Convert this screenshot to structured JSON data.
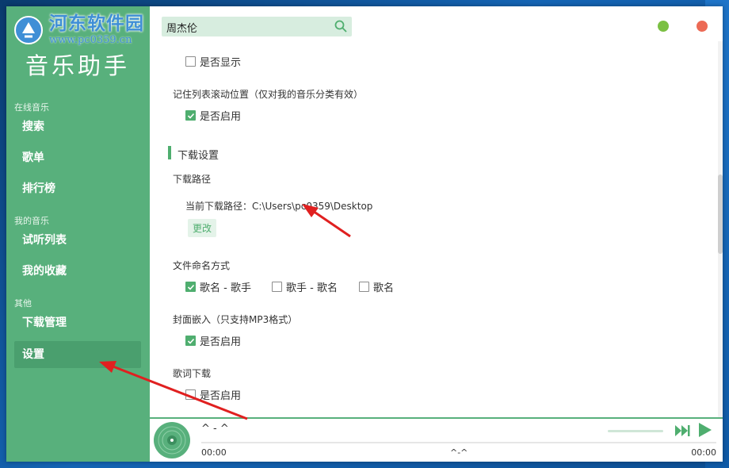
{
  "watermark": {
    "text": "河东软件园",
    "url": "www.pc0359.cn"
  },
  "app": {
    "title": "音乐助手"
  },
  "sidebar": {
    "sections": [
      {
        "label": "在线音乐",
        "items": [
          "搜索",
          "歌单",
          "排行榜"
        ]
      },
      {
        "label": "我的音乐",
        "items": [
          "试听列表",
          "我的收藏"
        ]
      },
      {
        "label": "其他",
        "items": [
          "下载管理",
          "设置"
        ]
      }
    ],
    "active_item": "设置"
  },
  "search": {
    "value": "周杰伦"
  },
  "settings": {
    "show_option": {
      "label": "是否显示",
      "checked": false
    },
    "remember_scroll": {
      "title": "记住列表滚动位置（仅对我的音乐分类有效）",
      "option": {
        "label": "是否启用",
        "checked": true
      }
    },
    "download_section_title": "下载设置",
    "download_path": {
      "title": "下载路径",
      "current_label": "当前下载路径：",
      "current_value": "C:\\Users\\pc0359\\Desktop",
      "change_label": "更改"
    },
    "file_naming": {
      "title": "文件命名方式",
      "options": [
        {
          "label": "歌名 - 歌手",
          "checked": true
        },
        {
          "label": "歌手 - 歌名",
          "checked": false
        },
        {
          "label": "歌名",
          "checked": false
        }
      ]
    },
    "cover_embed": {
      "title": "封面嵌入（只支持MP3格式）",
      "option": {
        "label": "是否启用",
        "checked": true
      }
    },
    "lyrics_download": {
      "title": "歌词下载",
      "option": {
        "label": "是否启用",
        "checked": false
      }
    }
  },
  "player": {
    "song": "^ - ^",
    "time_current": "00:00",
    "time_center": "^-^",
    "time_total": "00:00"
  },
  "colors": {
    "brand_green": "#58b07c",
    "accent_green": "#4fae6f",
    "minimize_dot": "#7bc043",
    "close_dot": "#ec6a55",
    "annotation_arrow": "#e02020"
  }
}
